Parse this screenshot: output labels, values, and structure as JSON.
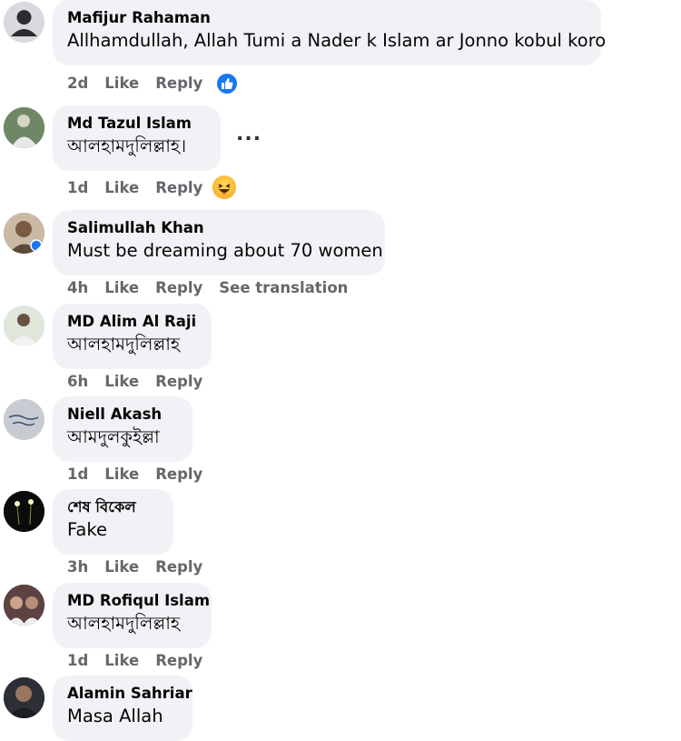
{
  "comments": [
    {
      "author": "Mafijur Rahaman",
      "text": "Allhamdullah, Allah Tumi a Nader k Islam ar Jonno kobul koro",
      "time": "2d",
      "like": "Like",
      "reply": "Reply",
      "reaction": "like-icon"
    },
    {
      "author": "Md Tazul Islam",
      "text": "আলহামদুলিল্লাহ।",
      "time": "1d",
      "like": "Like",
      "reply": "Reply",
      "reaction": "haha-icon",
      "more": "..."
    },
    {
      "author": "Salimullah Khan",
      "text": "Must be dreaming about 70 women",
      "time": "4h",
      "like": "Like",
      "reply": "Reply",
      "extra": "See translation"
    },
    {
      "author": "MD Alim Al Raji",
      "text": "আলহামদুলিল্লাহ",
      "time": "6h",
      "like": "Like",
      "reply": "Reply"
    },
    {
      "author": "Niell Akash",
      "text": "আমদুলকুইল্লা",
      "time": "1d",
      "like": "Like",
      "reply": "Reply"
    },
    {
      "author": "শেষ বিকেল",
      "text": "Fake",
      "time": "3h",
      "like": "Like",
      "reply": "Reply"
    },
    {
      "author": "MD Rofiqul Islam",
      "text": "আলহামদুলিল্লাহ",
      "time": "1d",
      "like": "Like",
      "reply": "Reply"
    },
    {
      "author": "Alamin Sahriar",
      "text": "Masa Allah"
    }
  ],
  "colors": {
    "bubble": "#f0f2f5",
    "meta": "#65676b",
    "like_blue": "#1877f2"
  }
}
